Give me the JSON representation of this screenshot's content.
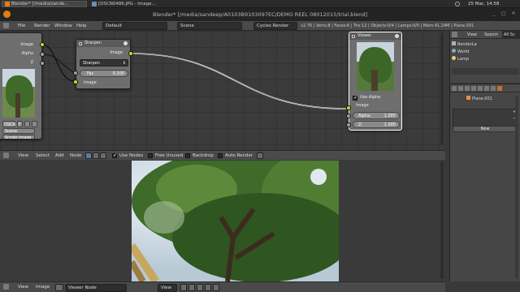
{
  "taskbar": {
    "tasks": [
      {
        "label": "Blender* [/media/sande..."
      },
      {
        "label": "[DSCN0486.JPG - Image..."
      }
    ],
    "clock": "25 Mar, 14:58"
  },
  "window": {
    "title": "Blender* [/media/sandeep/A0103B9103097EC/DEMO REEL 08012015/trial.blend]",
    "minimize": "_",
    "maximize": "□",
    "close": "✕"
  },
  "infobar": {
    "menus": [
      "File",
      "Render",
      "Window",
      "Help"
    ],
    "layout": "Default",
    "scene": "Scene",
    "engine": "Cycles Render",
    "stats": "v2.76 | Verts:8 | Faces:6 | Tris:12 | Objects:0/4 | Lamps:0/0 | Mem:41.24M | Plane.001"
  },
  "nodes": {
    "image_node": {
      "out_image": "Image",
      "out_alpha": "Alpha",
      "out_z": "Z",
      "file": "DSCN",
      "fake_user": "F",
      "source": "Scene",
      "type": "Single Image"
    },
    "sharpen": {
      "title": "Sharpen",
      "out_image": "Image",
      "filter": "Sharpen",
      "fac_label": "Fac",
      "fac_value": "0.200",
      "in_image": "Image"
    },
    "viewer": {
      "title": "Viewer",
      "use_alpha": "Use Alpha",
      "in_image": "Image",
      "alpha_label": "Alpha:",
      "alpha_value": "1.000",
      "z_label": "Z:",
      "z_value": "1.000"
    }
  },
  "node_header": {
    "menus": [
      "View",
      "Select",
      "Add",
      "Node"
    ],
    "use_nodes": "Use Nodes",
    "free_unused": "Free Unused",
    "backdrop": "Backdrop",
    "auto_render": "Auto Render"
  },
  "image_header": {
    "menus": [
      "View",
      "Image"
    ],
    "viewer": "Viewer Node",
    "view": "View"
  },
  "outliner": {
    "tabs": [
      "View",
      "Search",
      "All Sc"
    ],
    "items": [
      "RenderLa",
      "World",
      "Lamp"
    ]
  },
  "properties": {
    "object": "Plane.001",
    "new_button": "New"
  },
  "colors": {
    "socket_image": "#d6d628",
    "socket_value": "#a1a1a1",
    "socket_vector": "#6363c7",
    "selected_node_border": "#ffffff"
  }
}
